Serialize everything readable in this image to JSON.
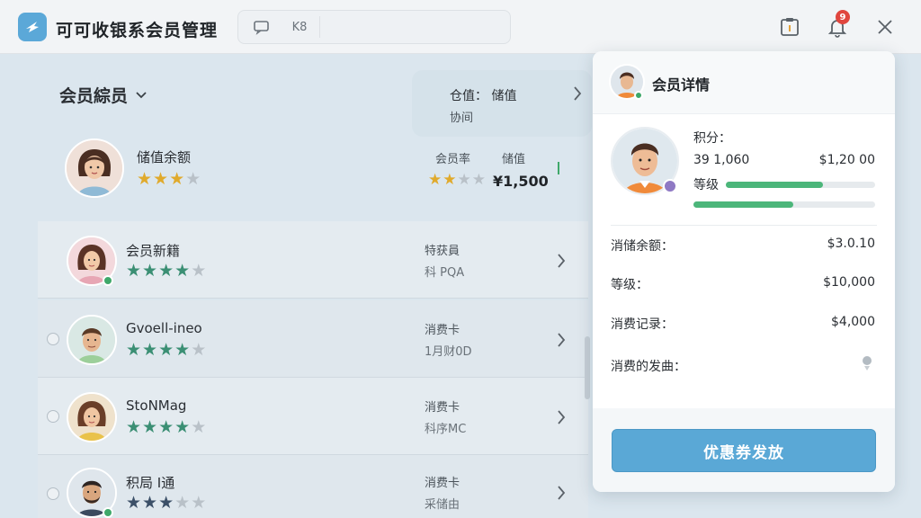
{
  "app": {
    "title": "可可收银系会员管理",
    "toolbar": {
      "btn2_label": "K8"
    }
  },
  "notifications": {
    "count": "9"
  },
  "list": {
    "section_title": "会员綜员",
    "info_card": {
      "line1": "仓值：  储值",
      "line2": "协间"
    },
    "featured": {
      "name": "储值余额",
      "stars_filled": 3,
      "stars_total": 4,
      "meta_label": "会员率",
      "meta_label2": "储值",
      "meta_stars_filled": 2,
      "meta_stars_total": 4,
      "meta_value": "¥1,500"
    },
    "rows": [
      {
        "name": "会员新籍",
        "stars_filled": 4,
        "stars_total": 5,
        "meta1": "特获員",
        "meta2": "科 PQA"
      },
      {
        "name": "Gvoell-ineo",
        "stars_filled": 4,
        "stars_total": 5,
        "meta1": "消费卡",
        "meta2": "1月财0D"
      },
      {
        "name": "StoNMag",
        "stars_filled": 4,
        "stars_total": 5,
        "meta1": "消费卡",
        "meta2": "科序MC"
      },
      {
        "name": "积局 I通",
        "stars_filled": 3,
        "stars_total": 5,
        "meta1": "消费卡",
        "meta2": "采储由"
      }
    ]
  },
  "detail": {
    "title": "会员详情",
    "points_label": "积分：",
    "points_row": {
      "left": "39  1,060",
      "right": "$1,20 00"
    },
    "level_label": "等级",
    "level_bar1": 0.65,
    "level_bar2": 0.55,
    "fields": [
      {
        "label": "消储余额：",
        "value": "$3.0.10"
      },
      {
        "label": "等级：",
        "value": "$10,000"
      },
      {
        "label": "消费记录：",
        "value": "$4,000"
      },
      {
        "label": "消费的发曲：",
        "value": ""
      }
    ],
    "coupon_button": "优惠券发放"
  },
  "colors": {
    "accent": "#5aa8d6",
    "star_gold": "#e0aa2c",
    "star_green": "#3b8f74",
    "star_empty": "#b9c1c8",
    "online": "#3fa86a"
  }
}
